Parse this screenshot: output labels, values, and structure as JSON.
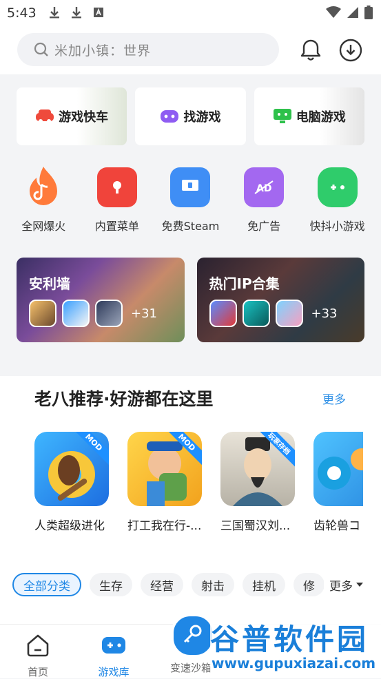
{
  "status_bar": {
    "time": "5:43"
  },
  "search": {
    "placeholder": "米加小镇：世界"
  },
  "category_cards": [
    {
      "label": "游戏快车",
      "icon": "car-icon",
      "color": "#ef4a3c"
    },
    {
      "label": "找游戏",
      "icon": "gamepad-icon",
      "color": "#8f5cf2"
    },
    {
      "label": "电脑游戏",
      "icon": "monitor-icon",
      "color": "#2ec14b"
    }
  ],
  "quick_entries": [
    {
      "label": "全网爆火",
      "icon": "flame-icon"
    },
    {
      "label": "内置菜单",
      "icon": "menu-card-icon"
    },
    {
      "label": "免费Steam",
      "icon": "steam-monitor-icon"
    },
    {
      "label": "免广告",
      "icon": "ad-block-icon"
    },
    {
      "label": "快抖小游戏",
      "icon": "mini-game-icon"
    }
  ],
  "banners": [
    {
      "title": "安利墙",
      "more": "+31"
    },
    {
      "title": "热门IP合集",
      "more": "+33"
    }
  ],
  "recommend": {
    "title": "老八推荐·好游都在这里",
    "more": "更多",
    "games": [
      {
        "name": "人类超级进化",
        "badge": "MOD"
      },
      {
        "name": "打工我在行-...",
        "badge": "MOD"
      },
      {
        "name": "三国蜀汉刘...",
        "badge": "玩家存档"
      },
      {
        "name": "齿轮兽コ",
        "badge": ""
      }
    ]
  },
  "categories": {
    "chips": [
      "全部分类",
      "生存",
      "经营",
      "射击",
      "挂机",
      "修"
    ],
    "more": "更多"
  },
  "tabbar": {
    "tabs": [
      "首页",
      "游戏库",
      "变速沙箱"
    ]
  },
  "watermark": {
    "title": "谷普软件园",
    "url": "www.gupuxiazai.com"
  }
}
